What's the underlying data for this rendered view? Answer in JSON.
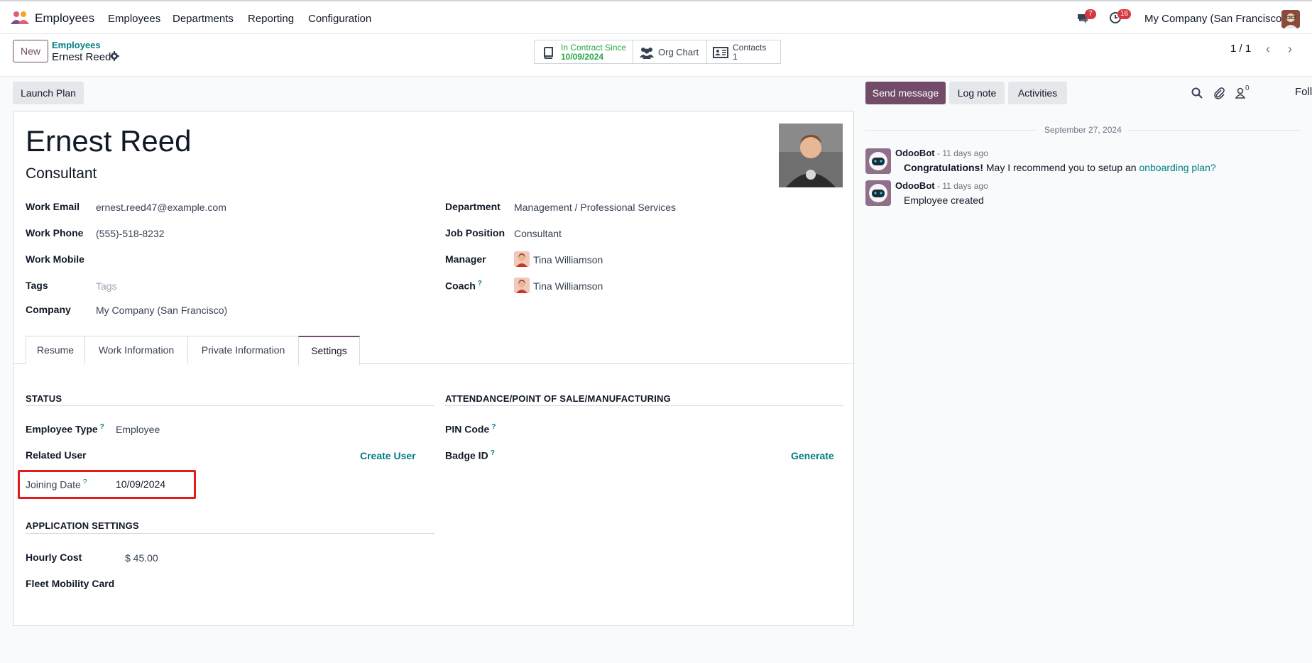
{
  "topbar": {
    "app_name": "Employees",
    "menu": [
      "Employees",
      "Departments",
      "Reporting",
      "Configuration"
    ],
    "messages_badge": "7",
    "activities_badge": "16",
    "company": "My Company (San Francisco)"
  },
  "controlbar": {
    "new_label": "New",
    "breadcrumb_parent": "Employees",
    "breadcrumb_current": "Ernest Reed",
    "contract_label": "In Contract Since",
    "contract_date": "10/09/2024",
    "org_chart_label": "Org Chart",
    "contacts_label": "Contacts",
    "contacts_count": "1",
    "pager": "1 / 1"
  },
  "actions": {
    "launch_plan": "Launch Plan"
  },
  "employee": {
    "name": "Ernest Reed",
    "job_title": "Consultant",
    "work_email_label": "Work Email",
    "work_email": "ernest.reed47@example.com",
    "work_phone_label": "Work Phone",
    "work_phone": "(555)-518-8232",
    "work_mobile_label": "Work Mobile",
    "tags_label": "Tags",
    "tags_placeholder": "Tags",
    "company_label": "Company",
    "company": "My Company (San Francisco)",
    "department_label": "Department",
    "department": "Management / Professional Services",
    "job_position_label": "Job Position",
    "job_position": "Consultant",
    "manager_label": "Manager",
    "manager": "Tina Williamson",
    "coach_label": "Coach",
    "coach": "Tina Williamson"
  },
  "tabs": [
    "Resume",
    "Work Information",
    "Private Information",
    "Settings"
  ],
  "settings": {
    "status_title": "STATUS",
    "employee_type_label": "Employee Type",
    "employee_type": "Employee",
    "related_user_label": "Related User",
    "create_user": "Create User",
    "joining_date_label": "Joining Date",
    "joining_date": "10/09/2024",
    "app_settings_title": "APPLICATION SETTINGS",
    "hourly_cost_label": "Hourly Cost",
    "hourly_cost": "$ 45.00",
    "fleet_card_label": "Fleet Mobility Card",
    "attendance_title": "ATTENDANCE/POINT OF SALE/MANUFACTURING",
    "pin_code_label": "PIN Code",
    "badge_id_label": "Badge ID",
    "generate": "Generate"
  },
  "chatter": {
    "send_message": "Send message",
    "log_note": "Log note",
    "activities": "Activities",
    "followers_count": "0",
    "follow": "Follow",
    "date_separator": "September 27, 2024",
    "messages": [
      {
        "author": "OdooBot",
        "meta": "- 11 days ago",
        "bold": "Congratulations!",
        "text": " May I recommend you to setup an ",
        "link": "onboarding plan?"
      },
      {
        "author": "OdooBot",
        "meta": "- 11 days ago",
        "text": "Employee created"
      }
    ]
  },
  "colors": {
    "brand": "#714b67",
    "link": "#017e84",
    "highlight": "#e41b1b",
    "badge": "#d9363e"
  }
}
